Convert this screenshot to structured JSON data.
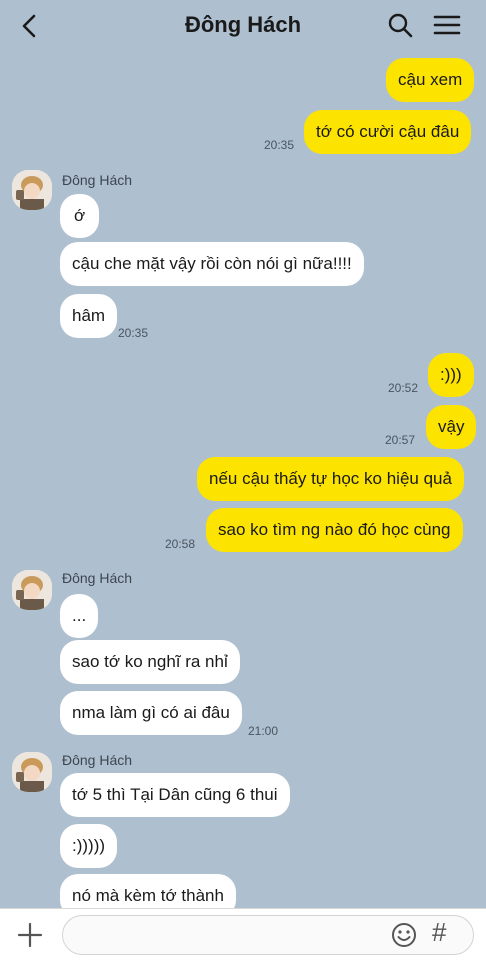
{
  "header": {
    "title": "Đông Hách"
  },
  "messages": [
    {
      "dir": "out",
      "text": "cậu xem"
    },
    {
      "dir": "out",
      "text": "tớ có cười cậu đâu",
      "time": "20:35"
    },
    {
      "dir": "in",
      "sender": "Đông Hách",
      "text": "ớ"
    },
    {
      "dir": "in",
      "text": "cậu che mặt vậy rồi còn nói gì nữa!!!!"
    },
    {
      "dir": "in",
      "text": "hâm",
      "time": "20:35"
    },
    {
      "dir": "out",
      "text": ":)))",
      "time": "20:52"
    },
    {
      "dir": "out",
      "text": "vậy",
      "time": "20:57"
    },
    {
      "dir": "out",
      "text": "nếu cậu thấy tự học ko hiệu quả"
    },
    {
      "dir": "out",
      "text": "sao ko tìm ng nào đó học cùng",
      "time": "20:58"
    },
    {
      "dir": "in",
      "sender": "Đông Hách",
      "text": "..."
    },
    {
      "dir": "in",
      "text": "sao tớ ko nghĩ ra nhỉ"
    },
    {
      "dir": "in",
      "text": "nma làm gì có ai đâu",
      "time": "21:00"
    },
    {
      "dir": "in",
      "sender": "Đông Hách",
      "text": "tớ 5 thì Tại Dân cũng 6 thui"
    },
    {
      "dir": "in",
      "text": ":)))))"
    },
    {
      "dir": "in",
      "text": "nó mà kèm tớ thành"
    }
  ],
  "icons": {
    "back": "chevron-left-icon",
    "search": "search-icon",
    "menu": "menu-icon",
    "add": "plus-icon",
    "emoji": "emoji-icon",
    "hashtag": "hashtag-icon"
  },
  "colors": {
    "background": "#aebfcf",
    "outgoing_bubble": "#fde300",
    "incoming_bubble": "#ffffff"
  },
  "input": {
    "hashtag_glyph": "#"
  }
}
